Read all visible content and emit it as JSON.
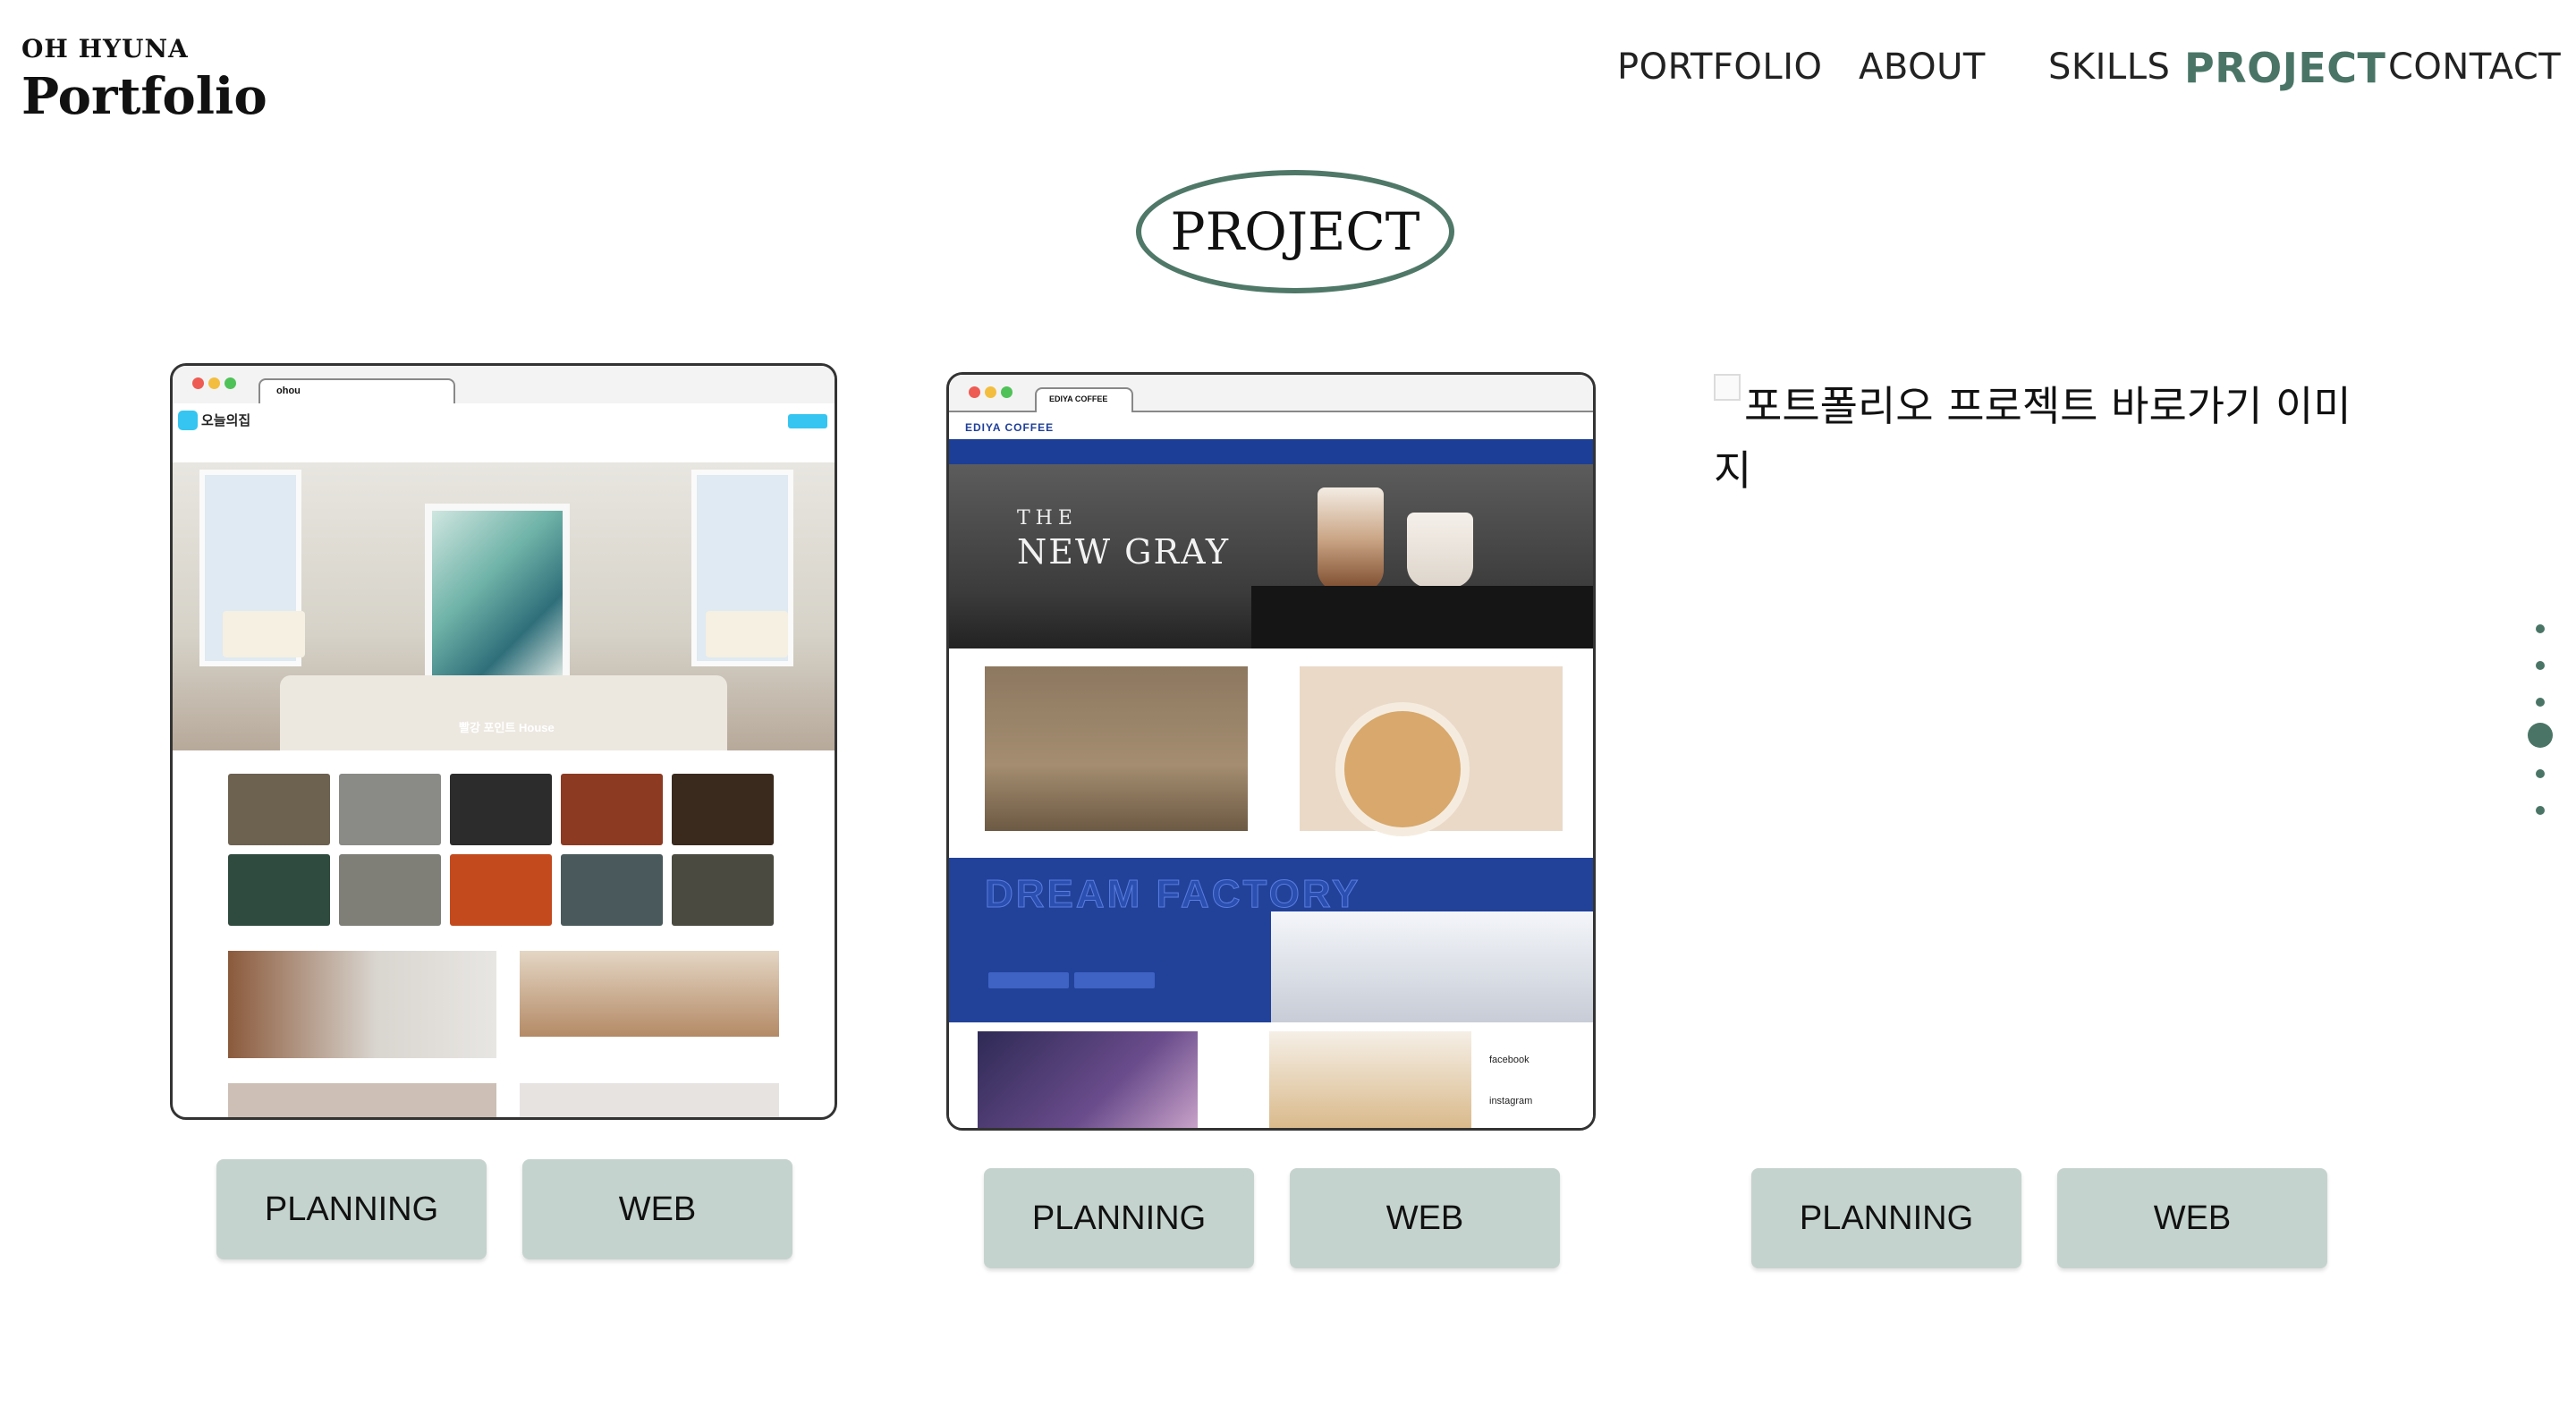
{
  "header": {
    "brand_sub": "OH HYUNA",
    "brand_title": "Portfolio",
    "nav": [
      {
        "label": "PORTFOLIO",
        "active": false
      },
      {
        "label": "ABOUT",
        "active": false
      },
      {
        "label": "SKILLS",
        "active": false
      },
      {
        "label": "PROJECT",
        "active": true
      },
      {
        "label": "CONTACT",
        "active": false
      }
    ]
  },
  "section": {
    "title": "PROJECT",
    "accent_color": "#4a7566",
    "button_color": "#c5d3ce"
  },
  "projects": [
    {
      "tab": "ohou",
      "site_name": "오늘의집",
      "hero_caption": "빨강 포인트 House",
      "buttons": {
        "planning": "PLANNING",
        "web": "WEB"
      }
    },
    {
      "tab": "EDIYA COFFEE",
      "site_name": "EDIYA COFFEE",
      "hero_line1": "THE",
      "hero_line2": "NEW GRAY",
      "banner_text": "DREAM FACTORY",
      "footer_links": [
        "facebook",
        "instagram"
      ],
      "buttons": {
        "planning": "PLANNING",
        "web": "WEB"
      }
    },
    {
      "image_alt": "포트폴리오 프로젝트 바로가기 이미지",
      "buttons": {
        "planning": "PLANNING",
        "web": "WEB"
      }
    }
  ],
  "pager": {
    "count": 6,
    "active_index": 3
  }
}
